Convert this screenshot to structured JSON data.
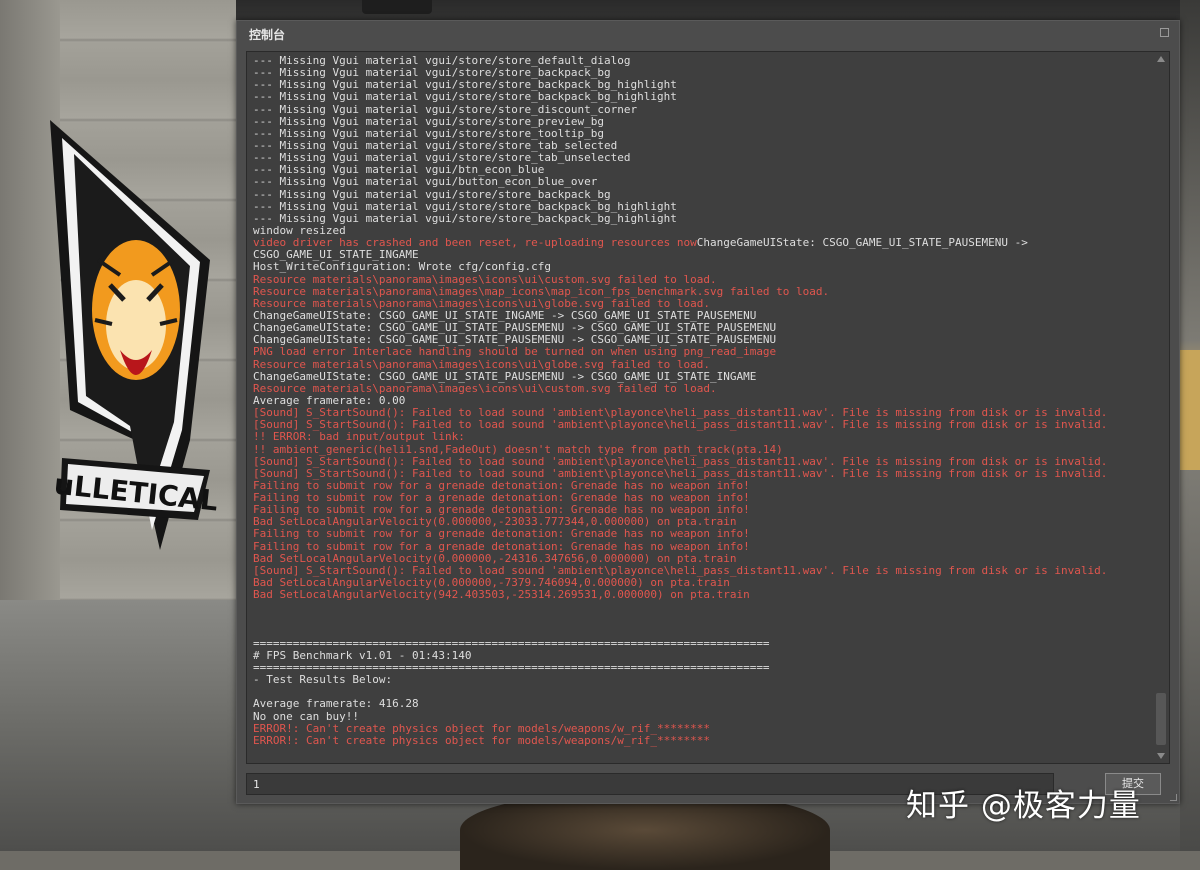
{
  "window": {
    "title": "控制台",
    "input_value": "1",
    "submit_label": "提交"
  },
  "watermark": "知乎 @极客力量",
  "logo": {
    "text": "uLLETICAL"
  },
  "colors": {
    "log_text": "#dedede",
    "log_error": "#e0564e",
    "panel_bg": "#3f3f3f",
    "window_bg": "#4c4c4c"
  },
  "log": [
    {
      "t": "--- Missing Vgui material vgui/store/store_default_dialog",
      "s": "normal"
    },
    {
      "t": "--- Missing Vgui material vgui/store/store_backpack_bg",
      "s": "normal"
    },
    {
      "t": "--- Missing Vgui material vgui/store/store_backpack_bg_highlight",
      "s": "normal"
    },
    {
      "t": "--- Missing Vgui material vgui/store/store_backpack_bg_highlight",
      "s": "normal"
    },
    {
      "t": "--- Missing Vgui material vgui/store/store_discount_corner",
      "s": "normal"
    },
    {
      "t": "--- Missing Vgui material vgui/store/store_preview_bg",
      "s": "normal"
    },
    {
      "t": "--- Missing Vgui material vgui/store/store_tooltip_bg",
      "s": "normal"
    },
    {
      "t": "--- Missing Vgui material vgui/store/store_tab_selected",
      "s": "normal"
    },
    {
      "t": "--- Missing Vgui material vgui/store/store_tab_unselected",
      "s": "normal"
    },
    {
      "t": "--- Missing Vgui material vgui/btn_econ_blue",
      "s": "normal"
    },
    {
      "t": "--- Missing Vgui material vgui/button_econ_blue_over",
      "s": "normal"
    },
    {
      "t": "--- Missing Vgui material vgui/store/store_backpack_bg",
      "s": "normal"
    },
    {
      "t": "--- Missing Vgui material vgui/store/store_backpack_bg_highlight",
      "s": "normal"
    },
    {
      "t": "--- Missing Vgui material vgui/store/store_backpack_bg_highlight",
      "s": "normal"
    },
    {
      "t": "window resized",
      "s": "normal"
    },
    {
      "t": "video driver has crashed and been reset, re-uploading resources now",
      "s": "error",
      "after": "ChangeGameUIState: CSGO_GAME_UI_STATE_PAUSEMENU ->"
    },
    {
      "t": "CSGO_GAME_UI_STATE_INGAME",
      "s": "normal"
    },
    {
      "t": "Host_WriteConfiguration: Wrote cfg/config.cfg",
      "s": "normal"
    },
    {
      "t": "Resource materials\\panorama\\images\\icons\\ui\\custom.svg failed to load.",
      "s": "error"
    },
    {
      "t": "Resource materials\\panorama\\images\\map_icons\\map_icon_fps_benchmark.svg failed to load.",
      "s": "error"
    },
    {
      "t": "Resource materials\\panorama\\images\\icons\\ui\\globe.svg failed to load.",
      "s": "error"
    },
    {
      "t": "ChangeGameUIState: CSGO_GAME_UI_STATE_INGAME -> CSGO_GAME_UI_STATE_PAUSEMENU",
      "s": "normal"
    },
    {
      "t": "ChangeGameUIState: CSGO_GAME_UI_STATE_PAUSEMENU -> CSGO_GAME_UI_STATE_PAUSEMENU",
      "s": "normal"
    },
    {
      "t": "ChangeGameUIState: CSGO_GAME_UI_STATE_PAUSEMENU -> CSGO_GAME_UI_STATE_PAUSEMENU",
      "s": "normal"
    },
    {
      "t": "PNG load error Interlace handling should be turned on when using png_read_image",
      "s": "error"
    },
    {
      "t": "Resource materials\\panorama\\images\\icons\\ui\\globe.svg failed to load.",
      "s": "error"
    },
    {
      "t": "ChangeGameUIState: CSGO_GAME_UI_STATE_PAUSEMENU -> CSGO_GAME_UI_STATE_INGAME",
      "s": "normal"
    },
    {
      "t": "Resource materials\\panorama\\images\\icons\\ui\\custom.svg failed to load.",
      "s": "error"
    },
    {
      "t": "Average framerate: 0.00",
      "s": "normal"
    },
    {
      "t": "[Sound] S_StartSound(): Failed to load sound 'ambient\\playonce\\heli_pass_distant11.wav'. File is missing from disk or is invalid.",
      "s": "error"
    },
    {
      "t": "[Sound] S_StartSound(): Failed to load sound 'ambient\\playonce\\heli_pass_distant11.wav'. File is missing from disk or is invalid.",
      "s": "error"
    },
    {
      "t": "!! ERROR: bad input/output link:",
      "s": "error"
    },
    {
      "t": "!! ambient_generic(heli1.snd,FadeOut) doesn't match type from path_track(pta.14)",
      "s": "error"
    },
    {
      "t": "[Sound] S_StartSound(): Failed to load sound 'ambient\\playonce\\heli_pass_distant11.wav'. File is missing from disk or is invalid.",
      "s": "error"
    },
    {
      "t": "[Sound] S_StartSound(): Failed to load sound 'ambient\\playonce\\heli_pass_distant11.wav'. File is missing from disk or is invalid.",
      "s": "error"
    },
    {
      "t": "Failing to submit row for a grenade detonation: Grenade has no weapon info!",
      "s": "error"
    },
    {
      "t": "Failing to submit row for a grenade detonation: Grenade has no weapon info!",
      "s": "error"
    },
    {
      "t": "Failing to submit row for a grenade detonation: Grenade has no weapon info!",
      "s": "error"
    },
    {
      "t": "Bad SetLocalAngularVelocity(0.000000,-23033.777344,0.000000) on pta.train",
      "s": "error"
    },
    {
      "t": "Failing to submit row for a grenade detonation: Grenade has no weapon info!",
      "s": "error"
    },
    {
      "t": "Failing to submit row for a grenade detonation: Grenade has no weapon info!",
      "s": "error"
    },
    {
      "t": "Bad SetLocalAngularVelocity(0.000000,-24316.347656,0.000000) on pta.train",
      "s": "error"
    },
    {
      "t": "[Sound] S_StartSound(): Failed to load sound 'ambient\\playonce\\heli_pass_distant11.wav'. File is missing from disk or is invalid.",
      "s": "error"
    },
    {
      "t": "Bad SetLocalAngularVelocity(0.000000,-7379.746094,0.000000) on pta.train",
      "s": "error"
    },
    {
      "t": "Bad SetLocalAngularVelocity(942.403503,-25314.269531,0.000000) on pta.train",
      "s": "error"
    },
    {
      "t": " ",
      "s": "blank"
    },
    {
      "t": " ",
      "s": "blank"
    },
    {
      "t": " ",
      "s": "blank"
    },
    {
      "t": "==============================================================================",
      "s": "normal"
    },
    {
      "t": "# FPS Benchmark v1.01 - 01:43:140",
      "s": "normal"
    },
    {
      "t": "==============================================================================",
      "s": "normal"
    },
    {
      "t": "- Test Results Below:",
      "s": "normal"
    },
    {
      "t": " ",
      "s": "blank"
    },
    {
      "t": "Average framerate: 416.28",
      "s": "normal"
    },
    {
      "t": "No one can buy!!",
      "s": "normal"
    },
    {
      "t": "ERROR!: Can't create physics object for models/weapons/w_rif_********",
      "s": "error"
    },
    {
      "t": "ERROR!: Can't create physics object for models/weapons/w_rif_********",
      "s": "error"
    }
  ]
}
